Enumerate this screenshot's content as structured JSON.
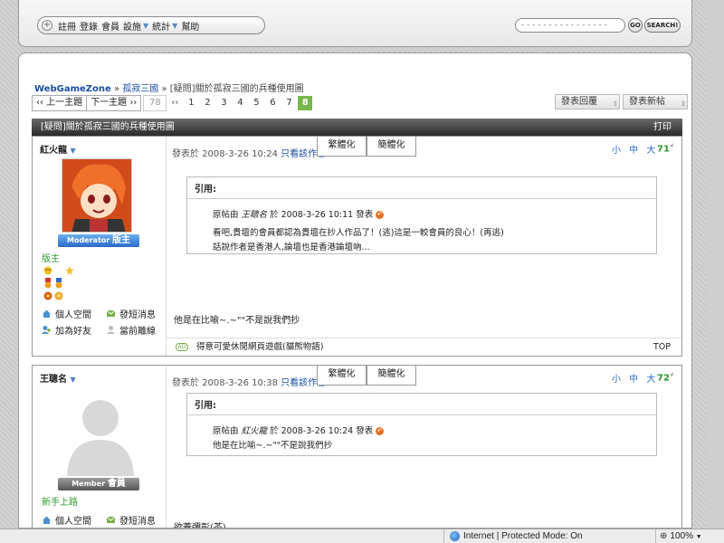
{
  "top_nav": {
    "items": [
      {
        "label": "註冊",
        "dropdown": false
      },
      {
        "label": "登錄",
        "dropdown": false
      },
      {
        "label": "會員",
        "dropdown": false
      },
      {
        "label": "設施",
        "dropdown": true
      },
      {
        "label": "統計",
        "dropdown": true
      },
      {
        "label": "幫助",
        "dropdown": false
      }
    ],
    "search_placeholder": "- - - - - - - - - - - - - - - -",
    "go_label": "GO",
    "search_label": "SEARCH!"
  },
  "breadcrumb": {
    "site": "WebGameZone",
    "sep1": " » ",
    "forum": "孤寂三國",
    "sep2": " » ",
    "thread": "[疑問]關於孤寂三國的兵種使用圖"
  },
  "thread_nav": {
    "prev": "‹‹ 上一主題",
    "next": "下一主題 ››"
  },
  "pagination": {
    "first": "78",
    "prev": "‹‹",
    "pages": [
      "1",
      "2",
      "3",
      "4",
      "5",
      "6",
      "7",
      "8"
    ],
    "current": "8"
  },
  "actions": {
    "reply": "發表回覆",
    "new_post": "發表新帖"
  },
  "thread": {
    "title": "[疑問]關於孤寂三國的兵種使用圖",
    "print": "打印"
  },
  "posts": [
    {
      "author": "紅火龍",
      "rank_en": "Moderator",
      "rank_zh": "版主",
      "group": "版主",
      "posted_prefix": "發表於",
      "posted_at": "2008-3-26 10:24",
      "only_author": "只看該作者",
      "tab_traditional": "繁體化",
      "tab_simplified": "簡體化",
      "size_controls": "小 中 大",
      "floor": "71",
      "quote_label": "引用:",
      "quote_origin_prefix": "原帖由",
      "quote_author": "王聰名",
      "quote_origin_mid": "於 2008-3-26 10:11 發表",
      "quote_line1": "看吧,貴壇的會員都認為貴壇在抄人作品了！(逃)這是一較會員的良心！(再逃)",
      "quote_line2": "話說作者是香港人,論壇也是香港論壇吶...",
      "body": "他是在比喻~.~\"\"不是說我們抄",
      "links": {
        "space": "個人空間",
        "pm": "發短消息",
        "friend": "加為好友",
        "online": "當前離線"
      },
      "footer_ad": "得意可愛休閒網頁遊戲(貓熊物語)",
      "top": "TOP"
    },
    {
      "author": "王聰名",
      "rank_en": "Member",
      "rank_zh": "會員",
      "group": "新手上路",
      "posted_prefix": "發表於",
      "posted_at": "2008-3-26 10:38",
      "only_author": "只看該作者",
      "tab_traditional": "繁體化",
      "tab_simplified": "簡體化",
      "size_controls": "小 中 大",
      "floor": "72",
      "quote_label": "引用:",
      "quote_origin_prefix": "原帖由",
      "quote_author": "紅火龍",
      "quote_origin_mid": "於 2008-3-26 10:24 發表",
      "quote_line1": "他是在比喻~.~\"\"不是說我們抄",
      "body": "欲蓋彌彰(茶)",
      "links": {
        "space": "個人空間",
        "pm": "發短消息"
      }
    }
  ],
  "statusbar": {
    "zone": "Internet | Protected Mode: On",
    "zoom": "100%"
  },
  "colors": {
    "accent_green": "#77b84a",
    "link_blue": "#1a4fa0",
    "moderator_blue": "#2a6ac8"
  }
}
